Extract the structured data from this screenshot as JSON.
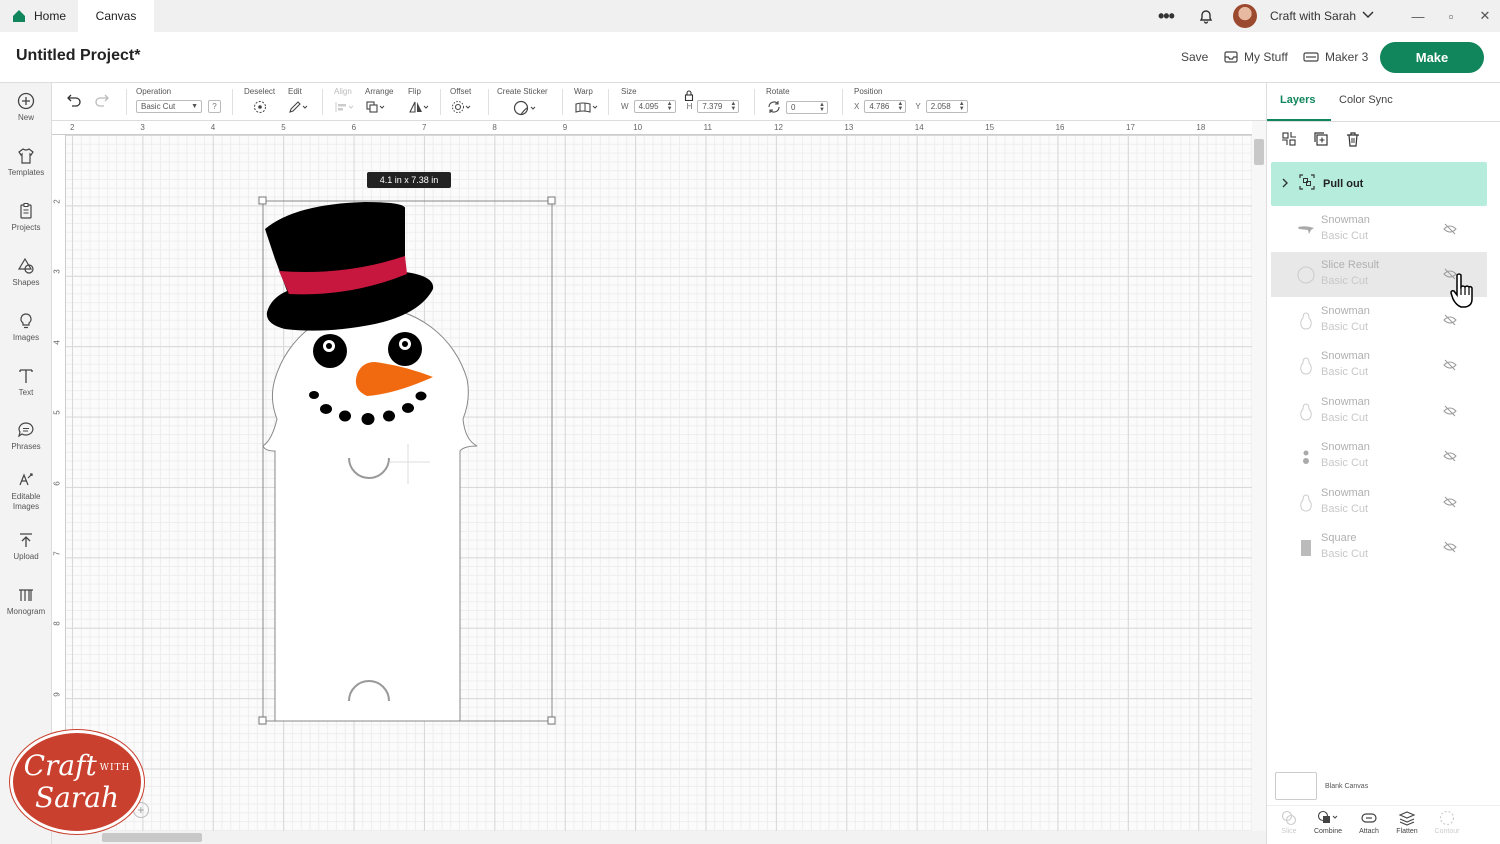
{
  "titlebar": {
    "home_tab": "Home",
    "canvas_tab": "Canvas",
    "more": "•••",
    "account_name": "Craft with Sarah",
    "min": "—",
    "max": "▫",
    "close": "✕"
  },
  "header": {
    "project_title": "Untitled Project*",
    "save": "Save",
    "my_stuff": "My Stuff",
    "machine": "Maker 3",
    "make": "Make"
  },
  "sidebar": {
    "items": [
      {
        "label": "New",
        "icon": "plus-circle-icon"
      },
      {
        "label": "Templates",
        "icon": "shirt-icon"
      },
      {
        "label": "Projects",
        "icon": "clipboard-icon"
      },
      {
        "label": "Shapes",
        "icon": "shapes-icon"
      },
      {
        "label": "Images",
        "icon": "lightbulb-icon"
      },
      {
        "label": "Text",
        "icon": "text-icon"
      },
      {
        "label": "Phrases",
        "icon": "speech-bubble-icon"
      },
      {
        "label": "Editable Images",
        "icon": "editable-images-icon"
      },
      {
        "label": "Upload",
        "icon": "upload-icon"
      },
      {
        "label": "Monogram",
        "icon": "monogram-icon"
      }
    ]
  },
  "toolbar": {
    "operation_label": "Operation",
    "operation_value": "Basic Cut",
    "operation_help": "?",
    "deselect_label": "Deselect",
    "edit_label": "Edit",
    "align_label": "Align",
    "arrange_label": "Arrange",
    "flip_label": "Flip",
    "offset_label": "Offset",
    "create_sticker_label": "Create Sticker",
    "warp_label": "Warp",
    "size_label": "Size",
    "size_w_prefix": "W",
    "size_w": "4.095",
    "size_h_prefix": "H",
    "size_h": "7.379",
    "rotate_label": "Rotate",
    "rotate_value": "0",
    "position_label": "Position",
    "pos_x_prefix": "X",
    "pos_x": "4.786",
    "pos_y_prefix": "Y",
    "pos_y": "2.058"
  },
  "rulers": {
    "top": [
      "2",
      "3",
      "4",
      "5",
      "6",
      "7",
      "8",
      "9",
      "10",
      "11",
      "12",
      "13",
      "14",
      "15",
      "16",
      "17",
      "18"
    ],
    "left": [
      "2",
      "3",
      "4",
      "5",
      "6",
      "7",
      "8",
      "9"
    ]
  },
  "canvas": {
    "size_tooltip": "4.1  in x 7.38  in"
  },
  "layers_panel": {
    "tab_layers": "Layers",
    "tab_color_sync": "Color Sync",
    "group_name": "Pull out",
    "layers": [
      {
        "name": "Snowman",
        "op": "Basic Cut"
      },
      {
        "name": "Slice Result",
        "op": "Basic Cut"
      },
      {
        "name": "Snowman",
        "op": "Basic Cut"
      },
      {
        "name": "Snowman",
        "op": "Basic Cut"
      },
      {
        "name": "Snowman",
        "op": "Basic Cut"
      },
      {
        "name": "Snowman",
        "op": "Basic Cut"
      },
      {
        "name": "Snowman",
        "op": "Basic Cut"
      },
      {
        "name": "Square",
        "op": "Basic Cut"
      }
    ],
    "blank_canvas": "Blank Canvas",
    "bottom_tools": [
      "Slice",
      "Combine",
      "Attach",
      "Flatten",
      "Contour"
    ]
  },
  "watermark": {
    "line1": "Craft",
    "with": "WITH",
    "line2": "Sarah"
  },
  "colors": {
    "accent_green": "#11855c",
    "group_highlight": "#b6ecdc",
    "hat_band": "#c8173f",
    "nose": "#f26a0f"
  }
}
